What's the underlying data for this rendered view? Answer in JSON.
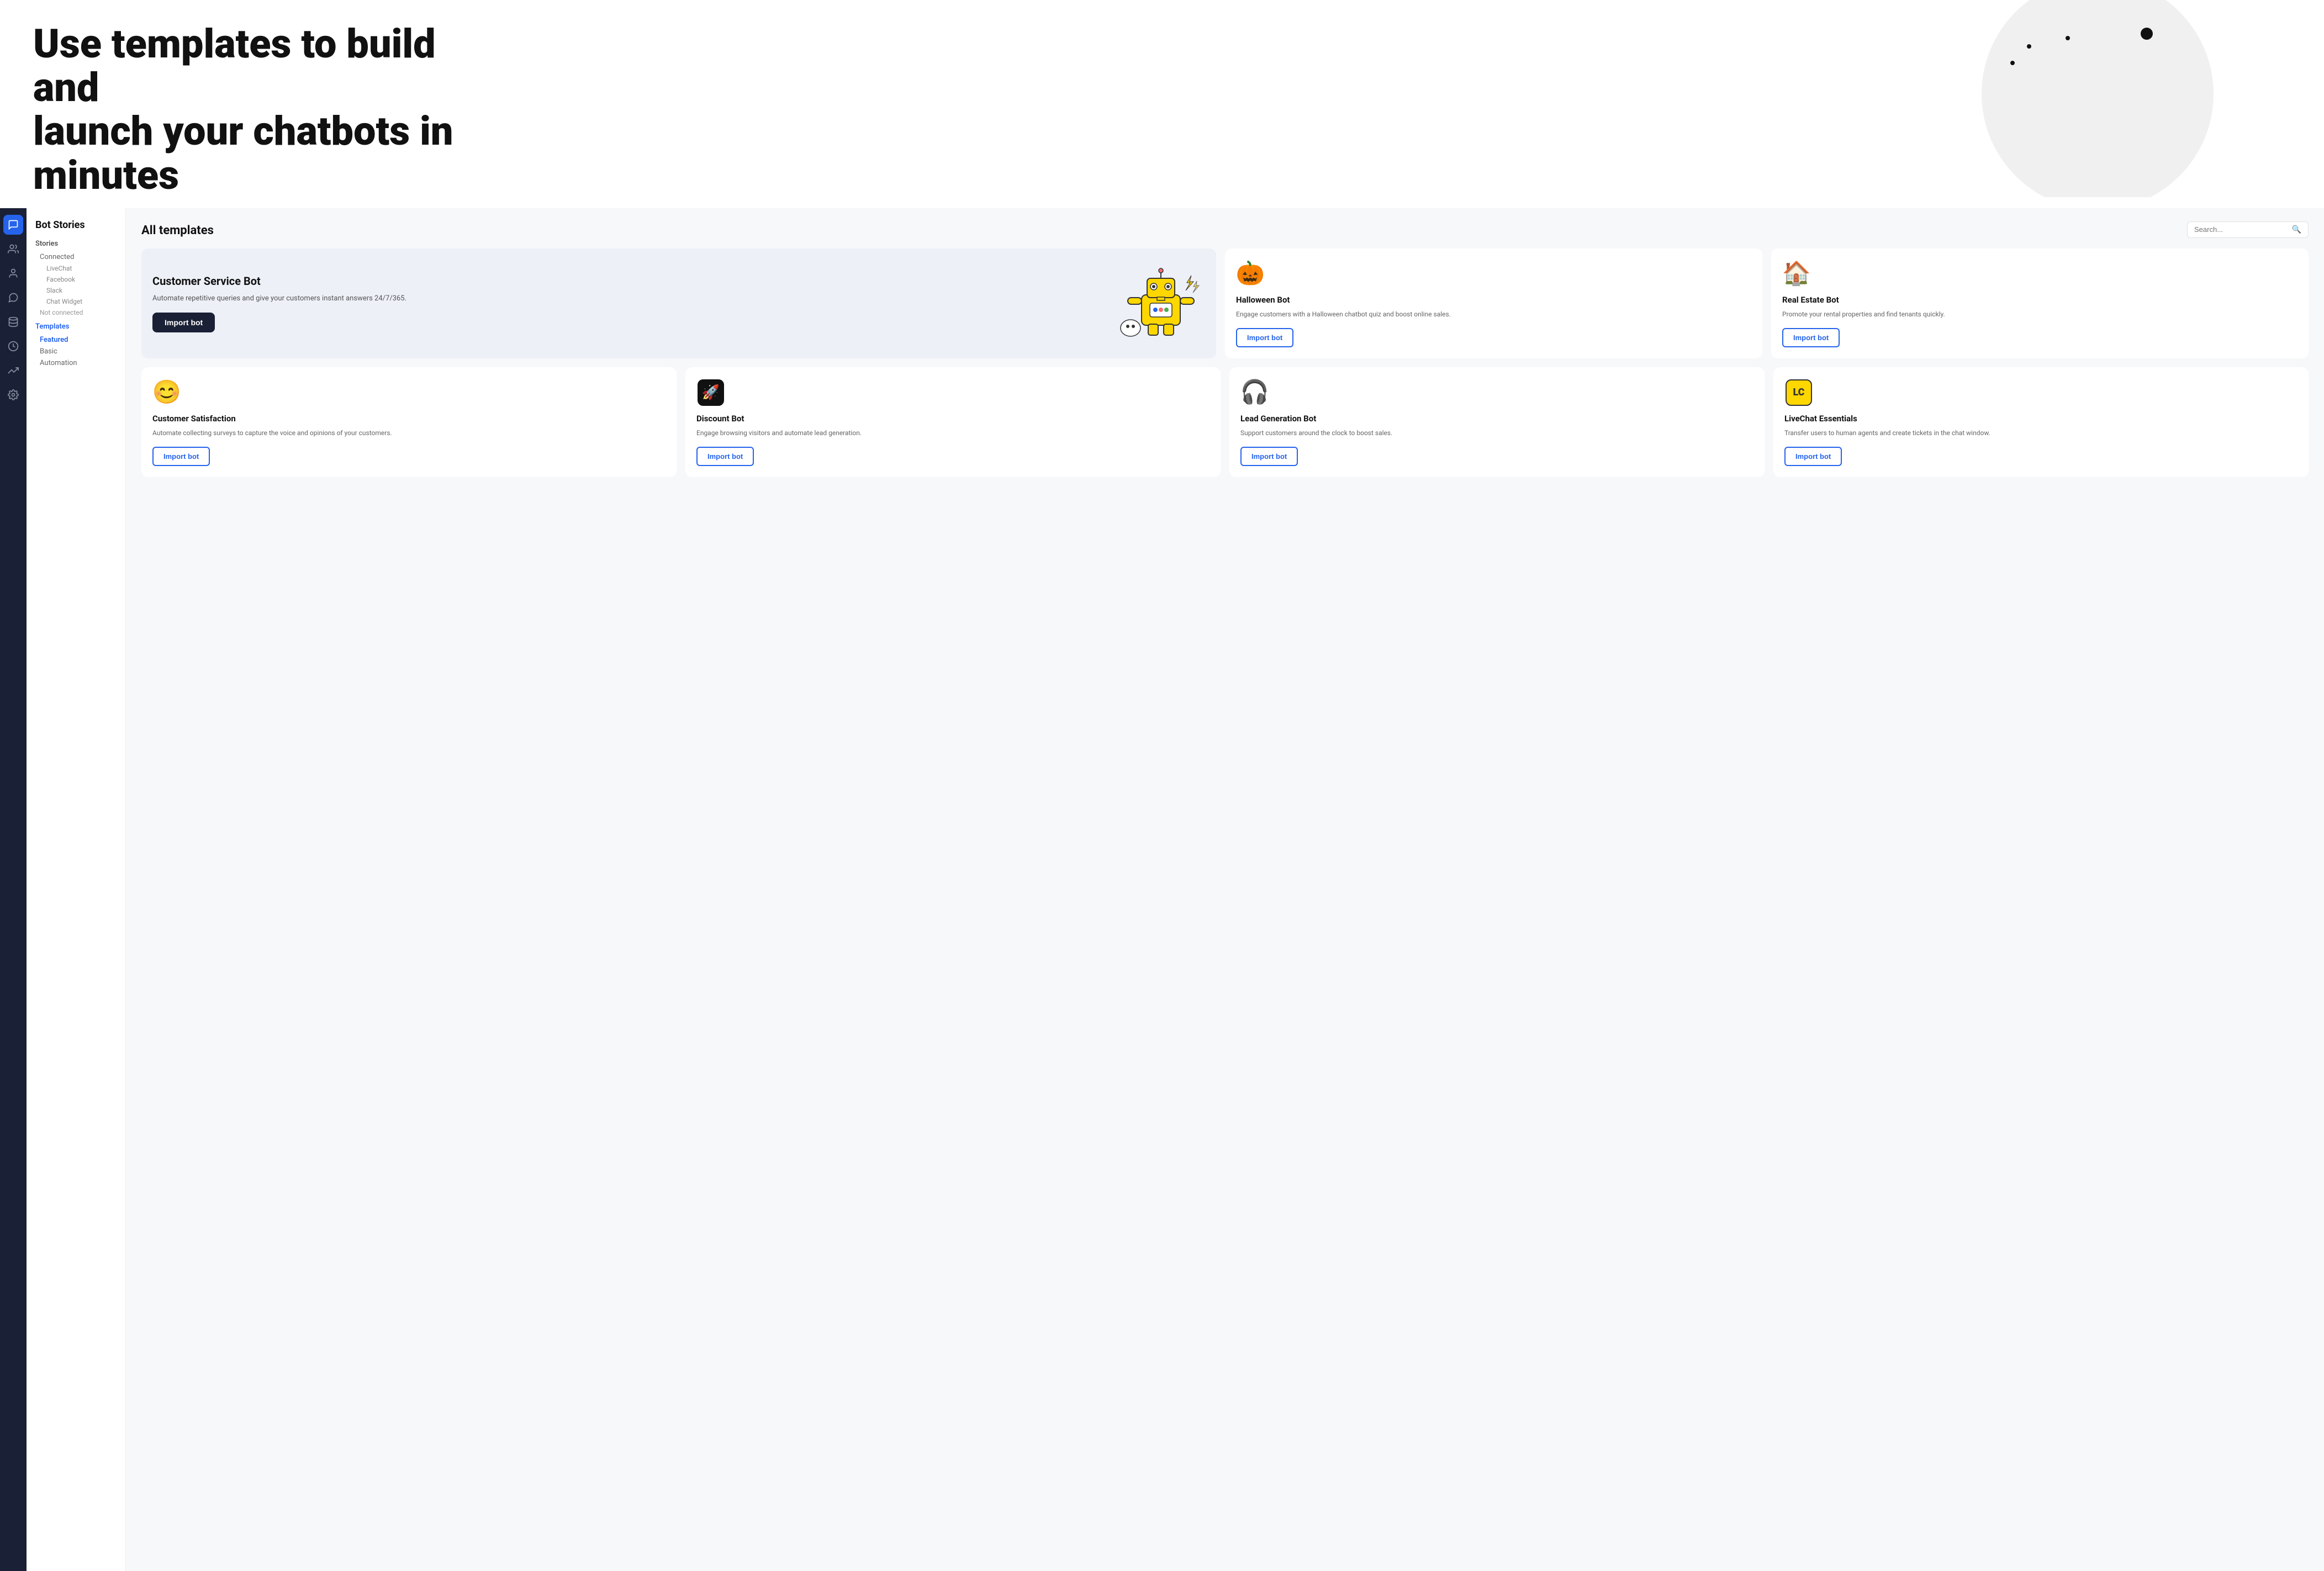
{
  "hero": {
    "title_line1": "Use templates to build and",
    "title_line2": "launch your chatbots in minutes"
  },
  "sidebar_nav": {
    "items": [
      {
        "name": "chat-icon",
        "icon": "💬",
        "active": true
      },
      {
        "name": "users-icon",
        "icon": "👥",
        "active": false
      },
      {
        "name": "contacts-icon",
        "icon": "👤",
        "active": false
      },
      {
        "name": "messages-icon",
        "icon": "🗨️",
        "active": false
      },
      {
        "name": "database-icon",
        "icon": "🗄️",
        "active": false
      },
      {
        "name": "clock-icon",
        "icon": "⏰",
        "active": false
      },
      {
        "name": "analytics-icon",
        "icon": "📈",
        "active": false
      },
      {
        "name": "settings-icon",
        "icon": "⚙️",
        "active": false
      }
    ]
  },
  "side_menu": {
    "title": "Bot Stories",
    "sections": [
      {
        "label": "Stories",
        "items": [
          {
            "text": "Connected",
            "indent": 0,
            "type": "item"
          },
          {
            "text": "LiveChat",
            "indent": 1,
            "type": "sub"
          },
          {
            "text": "Facebook",
            "indent": 1,
            "type": "sub"
          },
          {
            "text": "Slack",
            "indent": 1,
            "type": "sub"
          },
          {
            "text": "Chat Widget",
            "indent": 1,
            "type": "sub"
          },
          {
            "text": "Not connected",
            "indent": 0,
            "type": "divider"
          }
        ]
      },
      {
        "label": "Templates",
        "active": true,
        "items": [
          {
            "text": "Featured",
            "indent": 0,
            "type": "item"
          },
          {
            "text": "Basic",
            "indent": 0,
            "type": "item"
          },
          {
            "text": "Automation",
            "indent": 0,
            "type": "item"
          }
        ]
      }
    ]
  },
  "content": {
    "search_placeholder": "Search...",
    "section_title": "All templates",
    "featured_card": {
      "title": "Customer Service Bot",
      "description": "Automate repetitive queries and give your customers instant answers 24/7/365.",
      "button": "Import bot"
    },
    "cards_row1": [
      {
        "icon": "🎃",
        "title": "Halloween Bot",
        "description": "Engage customers with a Halloween chatbot quiz and boost online sales.",
        "button": "Import bot"
      },
      {
        "icon": "🏠",
        "title": "Real Estate Bot",
        "description": "Promote your rental properties and find tenants quickly.",
        "button": "Import bot"
      }
    ],
    "cards_row2": [
      {
        "icon": "😊",
        "title": "Customer Satisfaction",
        "description": "Automate collecting surveys to capture the voice and opinions of your customers.",
        "button": "Import bot"
      },
      {
        "icon": "🚀",
        "title": "Discount Bot",
        "description": "Engage browsing visitors and automate lead generation.",
        "button": "Import bot"
      },
      {
        "icon": "🎧",
        "title": "Lead Generation Bot",
        "description": "Support customers around the clock to boost sales.",
        "button": "Import bot"
      },
      {
        "icon": "LC",
        "title": "LiveChat Essentials",
        "description": "Transfer users to human agents and create tickets in the chat window.",
        "button": "Import bot"
      }
    ]
  }
}
